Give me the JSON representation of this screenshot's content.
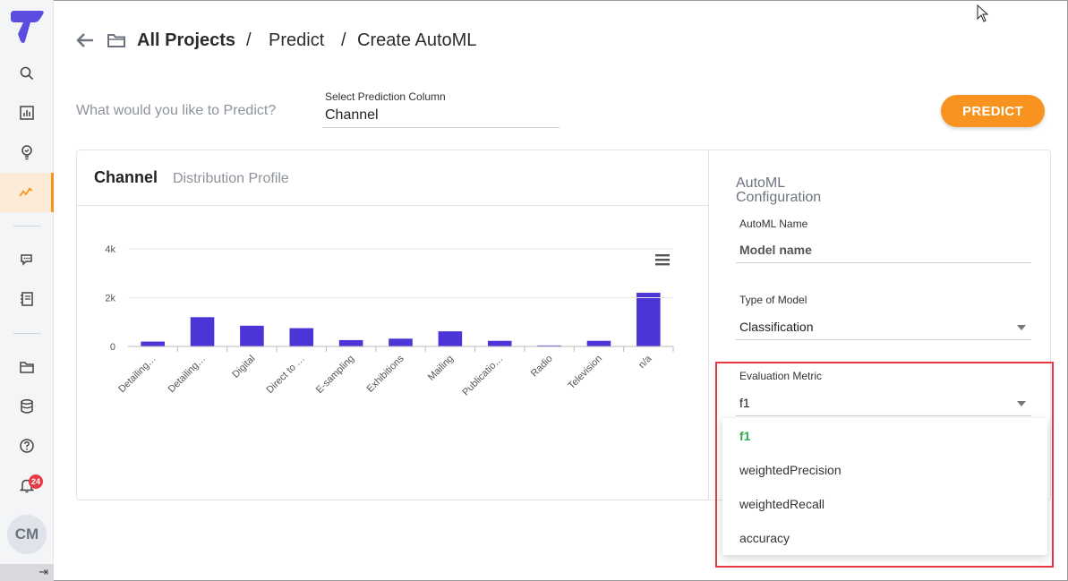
{
  "sidebar": {
    "notification_count": "24",
    "avatar_initials": "CM"
  },
  "breadcrumb": {
    "item1": "All Projects",
    "sep1": "/",
    "item2": "Predict",
    "sep2": "/",
    "item3": "Create AutoML"
  },
  "predict": {
    "question": "What would you like to Predict?",
    "column_label": "Select Prediction Column",
    "column_value": "Channel",
    "button_label": "PREDICT"
  },
  "profile": {
    "title": "Channel",
    "subtitle": "Distribution Profile"
  },
  "chart_data": {
    "type": "bar",
    "categories": [
      "Detailing…",
      "Detailing…",
      "Digital",
      "Direct to …",
      "E-sampling",
      "Exhibitions",
      "Mailing",
      "Publicatio…",
      "Radio",
      "Television",
      "n/a"
    ],
    "values": [
      200,
      1200,
      850,
      750,
      260,
      320,
      620,
      230,
      40,
      230,
      2200
    ],
    "yticks": [
      "4k",
      "2k",
      "0"
    ],
    "ylim": [
      0,
      4000
    ],
    "grid": true,
    "color": "#4b35d6"
  },
  "config": {
    "title": "AutoML Configuration",
    "name_label": "AutoML Name",
    "name_placeholder": "Model name",
    "type_label": "Type of Model",
    "type_value": "Classification",
    "metric_label": "Evaluation Metric",
    "metric_value": "f1",
    "metric_options": [
      "f1",
      "weightedPrecision",
      "weightedRecall",
      "accuracy"
    ]
  },
  "colors": {
    "accent": "#f7931e",
    "bar": "#4b35d6",
    "selected_option": "#2fa84f",
    "highlight": "#e53946"
  }
}
